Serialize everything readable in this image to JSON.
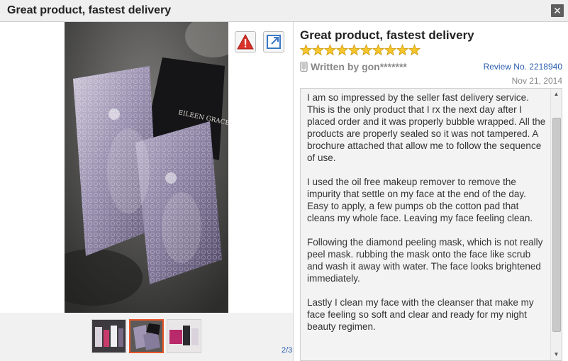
{
  "window": {
    "title": "Great product, fastest delivery",
    "close_glyph": "✕"
  },
  "gallery": {
    "counter": "2/3",
    "selected_index": 2,
    "total": 3,
    "thumbnails": [
      {
        "name": "thumbnail-1"
      },
      {
        "name": "thumbnail-2",
        "active": true
      },
      {
        "name": "thumbnail-3"
      }
    ],
    "main_photo_text": "EILEEN GRACE",
    "icons": [
      "report-icon",
      "expand-icon"
    ]
  },
  "review": {
    "title": "Great product, fastest delivery",
    "rating": 10,
    "rating_max": 10,
    "written_by_label": "Written by ",
    "author": "gon*******",
    "review_number": "Review No. 2218940",
    "date": "Nov 21, 2014",
    "paragraphs": [
      "I am so impressed by the seller fast delivery service. This is the only product that I rx the next day after I placed order and it was properly bubble wrapped. All the products are properly sealed so it was not tampered. A brochure attached that allow me to follow the sequence of use.",
      "I used the oil free makeup remover to remove the impurity that settle on my face at the end of the day. Easy to apply, a few pumps ob the cotton pad that cleans my whole face. Leaving my face feeling clean.",
      "Following the diamond peeling mask, which is not really peel mask. rubbing the mask onto the face like scrub and wash it away with water. The face looks brightened immediately.",
      "Lastly I clean my face with the cleanser that make my face feeling so soft and clear and ready for my night beauty regimen."
    ]
  },
  "colors": {
    "star": "#f6c62b",
    "active_thumb_border": "#e8562a",
    "link": "#2a5db0"
  }
}
